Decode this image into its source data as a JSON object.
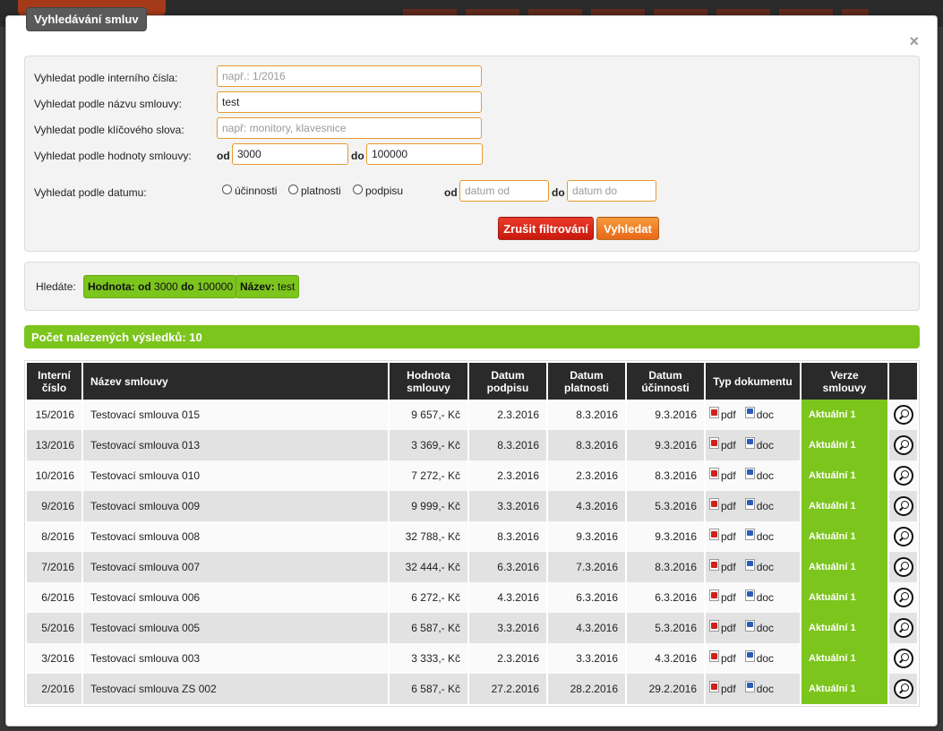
{
  "modal": {
    "title": "Vyhledávání smluv",
    "close_label": "×"
  },
  "search": {
    "internal_number": {
      "label": "Vyhledat podle interního čísla:",
      "value": "",
      "placeholder": "např.: 1/2016"
    },
    "contract_name": {
      "label": "Vyhledat podle názvu smlouvy:",
      "value": "test",
      "placeholder": ""
    },
    "keyword": {
      "label": "Vyhledat podle klíčového slova:",
      "value": "",
      "placeholder": "např: monitory, klavesnice"
    },
    "value_range": {
      "label": "Vyhledat podle hodnoty smlouvy:",
      "from_label": "od",
      "from_value": "3000",
      "to_label": "do",
      "to_value": "100000"
    },
    "date": {
      "label": "Vyhledat podle datumu:",
      "options": [
        "účinnosti",
        "platnosti",
        "podpisu"
      ],
      "from_label": "od",
      "from_placeholder": "datum od",
      "to_label": "do",
      "to_placeholder": "datum do"
    },
    "cancel_label": "Zrušit filtrování",
    "search_label": "Vyhledat"
  },
  "filters": {
    "label": "Hledáte:",
    "value_tag": {
      "key": "Hodnota:",
      "from_label": "od",
      "from_value": "3000",
      "to_label": "do",
      "to_value": "100000"
    },
    "name_tag": {
      "key": "Název:",
      "value": "test"
    }
  },
  "results": {
    "count_text": "Počet nalezených výsledků: 10"
  },
  "table": {
    "headers": {
      "number": [
        "Interní",
        "číslo"
      ],
      "name": "Název smlouvy",
      "value": [
        "Hodnota",
        "smlouvy"
      ],
      "signed": [
        "Datum",
        "podpisu"
      ],
      "valid": [
        "Datum",
        "platnosti"
      ],
      "effective": [
        "Datum",
        "účinnosti"
      ],
      "doc_type": "Typ dokumentu",
      "version": [
        "Verze",
        "smlouvy"
      ]
    },
    "rows": [
      {
        "number": "15/2016",
        "name": "Testovací smlouva 015",
        "value": "9 657,- Kč",
        "signed": "2.3.2016",
        "valid": "8.3.2016",
        "effective": "9.3.2016",
        "pdf": "pdf",
        "doc": "doc",
        "version": "Aktuální 1"
      },
      {
        "number": "13/2016",
        "name": "Testovací smlouva 013",
        "value": "3 369,- Kč",
        "signed": "8.3.2016",
        "valid": "8.3.2016",
        "effective": "9.3.2016",
        "pdf": "pdf",
        "doc": "doc",
        "version": "Aktuální 1"
      },
      {
        "number": "10/2016",
        "name": "Testovací smlouva 010",
        "value": "7 272,- Kč",
        "signed": "2.3.2016",
        "valid": "2.3.2016",
        "effective": "8.3.2016",
        "pdf": "pdf",
        "doc": "doc",
        "version": "Aktuální 1"
      },
      {
        "number": "9/2016",
        "name": "Testovací smlouva 009",
        "value": "9 999,- Kč",
        "signed": "3.3.2016",
        "valid": "4.3.2016",
        "effective": "5.3.2016",
        "pdf": "pdf",
        "doc": "doc",
        "version": "Aktuální 1"
      },
      {
        "number": "8/2016",
        "name": "Testovací smlouva 008",
        "value": "32 788,- Kč",
        "signed": "8.3.2016",
        "valid": "9.3.2016",
        "effective": "9.3.2016",
        "pdf": "pdf",
        "doc": "doc",
        "version": "Aktuální 1"
      },
      {
        "number": "7/2016",
        "name": "Testovací smlouva 007",
        "value": "32 444,- Kč",
        "signed": "6.3.2016",
        "valid": "7.3.2016",
        "effective": "8.3.2016",
        "pdf": "pdf",
        "doc": "doc",
        "version": "Aktuální 1"
      },
      {
        "number": "6/2016",
        "name": "Testovací smlouva 006",
        "value": "6 272,- Kč",
        "signed": "4.3.2016",
        "valid": "6.3.2016",
        "effective": "6.3.2016",
        "pdf": "pdf",
        "doc": "doc",
        "version": "Aktuální 1"
      },
      {
        "number": "5/2016",
        "name": "Testovací smlouva 005",
        "value": "6 587,- Kč",
        "signed": "3.3.2016",
        "valid": "4.3.2016",
        "effective": "5.3.2016",
        "pdf": "pdf",
        "doc": "doc",
        "version": "Aktuální 1"
      },
      {
        "number": "3/2016",
        "name": "Testovací smlouva 003",
        "value": "3 333,- Kč",
        "signed": "2.3.2016",
        "valid": "3.3.2016",
        "effective": "4.3.2016",
        "pdf": "pdf",
        "doc": "doc",
        "version": "Aktuální 1"
      },
      {
        "number": "2/2016",
        "name": "Testovací smlouva ZS 002",
        "value": "6 587,- Kč",
        "signed": "27.2.2016",
        "valid": "28.2.2016",
        "effective": "29.2.2016",
        "pdf": "pdf",
        "doc": "doc",
        "version": "Aktuální 1"
      }
    ]
  },
  "icons": {
    "pdf": "pdf-file-icon",
    "doc": "word-doc-icon",
    "detail": "magnifier-icon",
    "close": "close-icon"
  },
  "colors": {
    "accent_green": "#7cc51d",
    "accent_orange": "#e8691a",
    "accent_red": "#c9180d",
    "header_dark": "#2a2a2a",
    "input_border": "#e59a2c"
  }
}
